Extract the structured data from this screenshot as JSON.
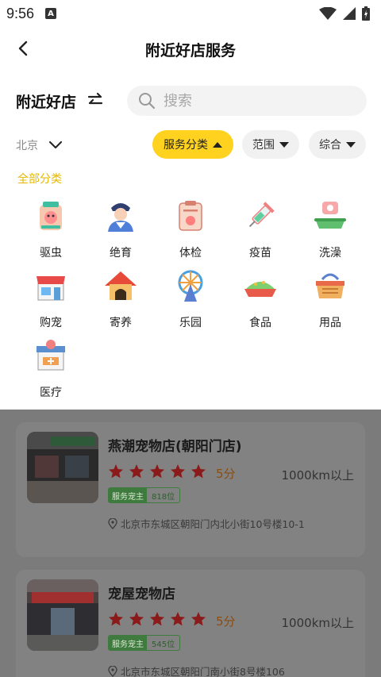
{
  "status_bar": {
    "time": "9:56",
    "notice_letter": "A"
  },
  "header": {
    "title": "附近好店服务"
  },
  "section": {
    "title": "附近好店"
  },
  "search": {
    "placeholder": "搜索"
  },
  "filters": {
    "city": "北京",
    "chips": [
      {
        "label": "服务分类",
        "active": true
      },
      {
        "label": "范围",
        "active": false
      },
      {
        "label": "综合",
        "active": false
      }
    ],
    "all_categories": "全部分类"
  },
  "categories": [
    {
      "label": "驱虫",
      "icon": "deworming-icon"
    },
    {
      "label": "绝育",
      "icon": "sterilization-icon"
    },
    {
      "label": "体检",
      "icon": "checkup-icon"
    },
    {
      "label": "疫苗",
      "icon": "vaccine-icon"
    },
    {
      "label": "洗澡",
      "icon": "bathing-icon"
    },
    {
      "label": "购宠",
      "icon": "pet-shop-icon"
    },
    {
      "label": "寄养",
      "icon": "boarding-icon"
    },
    {
      "label": "乐园",
      "icon": "park-icon"
    },
    {
      "label": "食品",
      "icon": "food-icon"
    },
    {
      "label": "用品",
      "icon": "supplies-icon"
    },
    {
      "label": "医疗",
      "icon": "medical-icon"
    }
  ],
  "shops": [
    {
      "name": "燕潮宠物店(朝阳门店)",
      "rating": 5,
      "score": "5分",
      "distance": "1000km以上",
      "badge_label": "服务宠主",
      "badge_count": "818位",
      "address": "北京市东城区朝阳门内北小街10号楼10-1"
    },
    {
      "name": "宠屋宠物店",
      "rating": 5,
      "score": "5分",
      "distance": "1000km以上",
      "badge_label": "服务宠主",
      "badge_count": "545位",
      "address": "北京市东城区朝阳门南小街8号楼106"
    }
  ],
  "colors": {
    "accent": "#ffd21f",
    "category_link": "#e6b800",
    "star": "#8b1a1a",
    "overlay": "#7b7b7b"
  }
}
